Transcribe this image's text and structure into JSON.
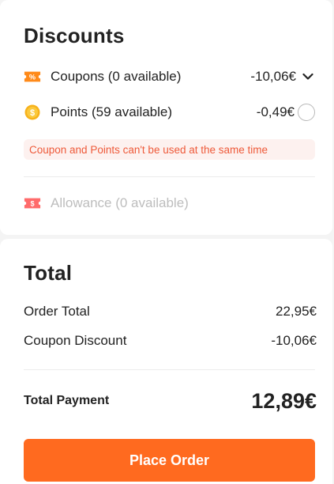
{
  "discounts": {
    "title": "Discounts",
    "coupons": {
      "label": "Coupons (0 available)",
      "amount": "-10,06€",
      "icon": "coupon-percent-icon"
    },
    "points": {
      "label": "Points (59 available)",
      "amount": "-0,49€",
      "icon": "points-coin-icon"
    },
    "warning": "Coupon and Points can't be used at the same time",
    "allowance": {
      "label": "Allowance (0 available)",
      "icon": "allowance-ticket-icon"
    }
  },
  "total": {
    "title": "Total",
    "order_total_label": "Order Total",
    "order_total_value": "22,95€",
    "coupon_discount_label": "Coupon Discount",
    "coupon_discount_value": "-10,06€",
    "total_payment_label": "Total Payment",
    "total_payment_value": "12,89€"
  },
  "place_order_label": "Place Order",
  "colors": {
    "accent": "#ff6a1f",
    "discount_red": "#ee3a2b",
    "warning_bg": "#fdf1ef",
    "warning_text": "#ee5a3a"
  }
}
